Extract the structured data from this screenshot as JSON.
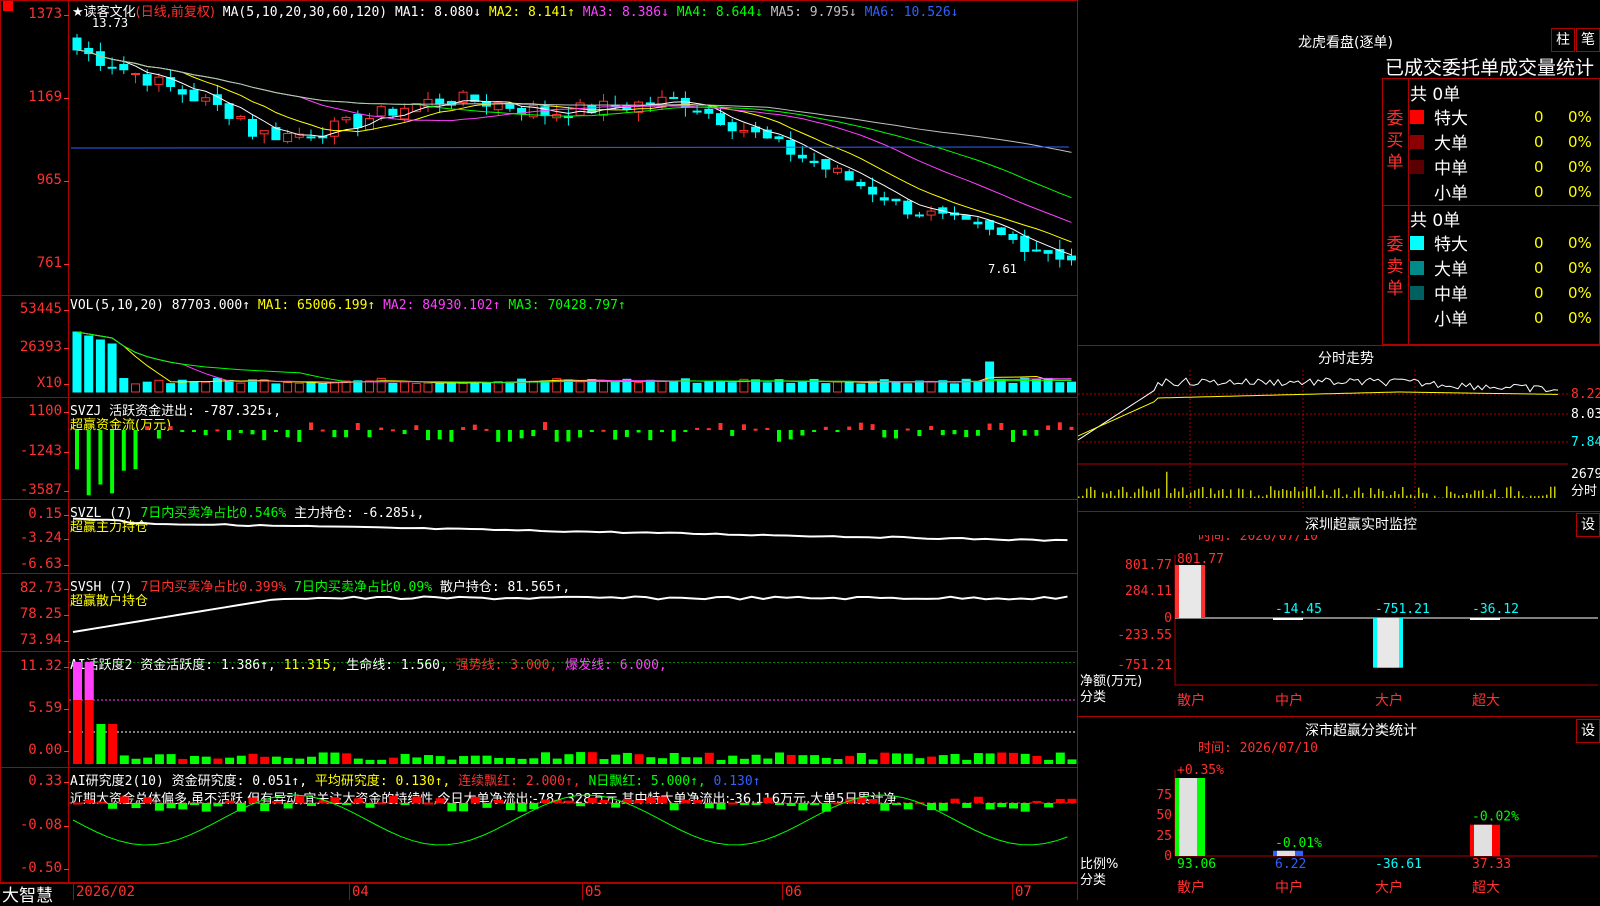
{
  "main_chart": {
    "stock_name": "★读客文化",
    "period_label": "(日线,前复权)",
    "ma_header": "MA(5,10,20,30,60,120)",
    "ma_values": [
      {
        "text": "MA1: 8.080↓",
        "color": "#ffffff"
      },
      {
        "text": "MA2: 8.141↑",
        "color": "#ffff00"
      },
      {
        "text": "MA3: 8.386↓",
        "color": "#ff40ff"
      },
      {
        "text": "MA4: 8.644↓",
        "color": "#00ff00"
      },
      {
        "text": "MA5: 9.795↓",
        "color": "#c0c0c0"
      },
      {
        "text": "MA6: 10.526↓",
        "color": "#3060ff"
      }
    ],
    "y_ticks": [
      "1373",
      "1169",
      "965",
      "761"
    ],
    "high_label": "13.73",
    "low_label": "7.61"
  },
  "volume_panel": {
    "title": "VOL(5,10,20)",
    "values": [
      {
        "text": "87703.000↑",
        "color": "#ffffff"
      },
      {
        "text": "MA1: 65006.199↑",
        "color": "#ffff00"
      },
      {
        "text": "MA2: 84930.102↑",
        "color": "#ff40ff"
      },
      {
        "text": "MA3: 70428.797↑",
        "color": "#00ff00"
      }
    ],
    "y_ticks": [
      "53445",
      "26393",
      "X10"
    ]
  },
  "svzj_panel": {
    "title": "SVZJ  活跃资金进出: -787.325↓,",
    "subtitle": "超赢资金流(万元)",
    "y_ticks": [
      "1100",
      "-1243",
      "-3587"
    ]
  },
  "svzl_panel": {
    "title_parts": [
      {
        "text": "SVZL (7) ",
        "color": "#ffffff"
      },
      {
        "text": "7日内买卖净占比0.546%",
        "color": "#00ff00"
      },
      {
        "text": " 主力持仓: -6.285↓,",
        "color": "#ffffff"
      }
    ],
    "subtitle": "超赢主力持仓",
    "y_ticks": [
      "0.15",
      "-3.24",
      "-6.63"
    ]
  },
  "svsh_panel": {
    "title_parts": [
      {
        "text": "SVSH (7) ",
        "color": "#ffffff"
      },
      {
        "text": "7日内买卖净占比0.399%",
        "color": "#ff3030"
      },
      {
        "text": " 7日内买卖净占比0.09%",
        "color": "#00ff00"
      },
      {
        "text": " 散户持仓: 81.565↑,",
        "color": "#ffffff"
      }
    ],
    "subtitle": "超赢散户持仓",
    "y_ticks": [
      "82.73",
      "78.25",
      "73.94"
    ]
  },
  "ai_active_panel": {
    "title_parts": [
      {
        "text": "AI活跃度2 资金活跃度: 1.386↑,",
        "color": "#ffffff"
      },
      {
        "text": " 11.315,",
        "color": "#ffff00"
      },
      {
        "text": " 生命线: 1.560,",
        "color": "#ffffff"
      },
      {
        "text": " 强势线: 3.000,",
        "color": "#ff3030"
      },
      {
        "text": " 爆发线: 6.000,",
        "color": "#ff40ff"
      }
    ],
    "y_ticks": [
      "11.32",
      "5.59",
      "0.00"
    ]
  },
  "ai_research_panel": {
    "title_parts": [
      {
        "text": "AI研究度2(10) 资金研究度: 0.051↑,",
        "color": "#ffffff"
      },
      {
        "text": " 平均研究度: 0.130↑,",
        "color": "#ffff00"
      },
      {
        "text": " 连续飘红: 2.000↑,",
        "color": "#ff3030"
      },
      {
        "text": " N日飘红: 5.000↑,",
        "color": "#00ff00"
      },
      {
        "text": " 0.130↑",
        "color": "#3060ff"
      }
    ],
    "commentary": "近期大资金总体偏多,虽不活跃,但有异动,宜关注大资金的持续性,今日大单净流出:-787.328万元,其中特大单净流出:-36.116万元,大单5日累计净",
    "y_ticks": [
      "0.33",
      "-0.08",
      "-0.50"
    ]
  },
  "bottom_bar": {
    "brand": "大智慧",
    "dates": [
      "2026/02",
      "04",
      "05",
      "06",
      "07"
    ]
  },
  "right_panel": {
    "lhb_title": "龙虎看盘(逐单)",
    "btn_column": "柱",
    "btn_pen": "笔",
    "tab_strip": "已成交委托单成交量统计",
    "buy_group": {
      "label": "委买单",
      "total": "共 0单",
      "rows": [
        {
          "name": "特大",
          "count": "0",
          "pct": "0%",
          "color": "#ff0000"
        },
        {
          "name": "大单",
          "count": "0",
          "pct": "0%",
          "color": "#8b0000"
        },
        {
          "name": "中单",
          "count": "0",
          "pct": "0%",
          "color": "#5a0000"
        },
        {
          "name": "小单",
          "count": "0",
          "pct": "0%",
          "color": "#000000"
        }
      ]
    },
    "sell_group": {
      "label": "委卖单",
      "total": "共 0单",
      "rows": [
        {
          "name": "特大",
          "count": "0",
          "pct": "0%",
          "color": "#00ffff"
        },
        {
          "name": "大单",
          "count": "0",
          "pct": "0%",
          "color": "#008b8b"
        },
        {
          "name": "中单",
          "count": "0",
          "pct": "0%",
          "color": "#006060"
        },
        {
          "name": "小单",
          "count": "0",
          "pct": "0%",
          "color": "#000000"
        }
      ]
    },
    "intraday": {
      "title": "分时走势",
      "prices": [
        "8.22",
        "8.03",
        "7.84"
      ],
      "vol_label": "2679",
      "vol_unit": "分时"
    },
    "sz_realtime": {
      "title": "深圳超赢实时监控",
      "settings": "设",
      "time": "时间: 2026/07/10",
      "y_ticks": [
        "801.77",
        "284.11",
        "0",
        "-233.55",
        "-751.21"
      ],
      "y_axis_label": "净额(万元)",
      "x_axis_label": "分类",
      "categories": [
        "散户",
        "中户",
        "大户",
        "超大"
      ],
      "values": [
        801.77,
        -14.45,
        -751.21,
        -36.12
      ],
      "value_labels": [
        "801.77",
        "-14.45",
        "-751.21",
        "-36.12"
      ]
    },
    "sz_classify": {
      "title": "深市超赢分类统计",
      "settings": "设",
      "time": "时间: 2026/07/10",
      "y_ticks": [
        "75",
        "50",
        "25",
        "0"
      ],
      "y_axis_label": "比例%",
      "x_axis_label": "分类",
      "categories": [
        "散户",
        "中户",
        "大户",
        "超大"
      ],
      "pct_labels": [
        "+0.35%",
        "-0.01%",
        "",
        "-0.02%"
      ],
      "bottom_values": [
        "93.06",
        "6.22",
        "-36.61",
        "37.33"
      ],
      "bar_heights": [
        93.06,
        6.22,
        0,
        37.33
      ]
    }
  }
}
